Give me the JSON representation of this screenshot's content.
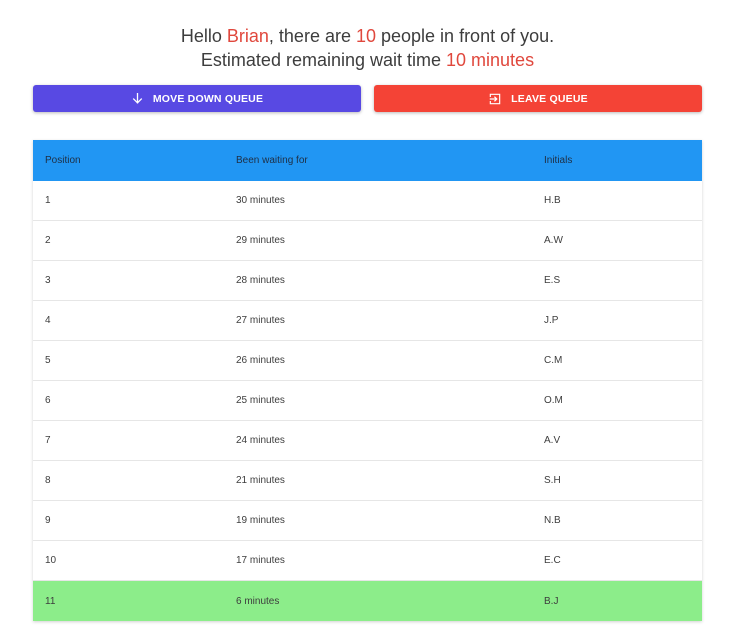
{
  "greeting": {
    "hello": "Hello ",
    "name": "Brian",
    "mid": ", there are ",
    "count": "10",
    "tail": " people in front of you.",
    "wait_prefix": "Estimated remaining wait time ",
    "wait_time": "10 minutes"
  },
  "actions": {
    "move_down_label": "MOVE DOWN QUEUE",
    "move_down_icon": "arrow-down-icon",
    "leave_label": "LEAVE QUEUE",
    "leave_icon": "exit-icon"
  },
  "colors": {
    "accent_text": "#e0483d",
    "move_button": "#5849e3",
    "leave_button": "#f44336",
    "header": "#2196f3",
    "current_user_row": "#8ced8a"
  },
  "table": {
    "headers": [
      "Position",
      "Been waiting for",
      "Initials"
    ],
    "rows": [
      {
        "position": "1",
        "waiting": "30 minutes",
        "initials": "H.B"
      },
      {
        "position": "2",
        "waiting": "29 minutes",
        "initials": "A.W"
      },
      {
        "position": "3",
        "waiting": "28 minutes",
        "initials": "E.S"
      },
      {
        "position": "4",
        "waiting": "27 minutes",
        "initials": "J.P"
      },
      {
        "position": "5",
        "waiting": "26 minutes",
        "initials": "C.M"
      },
      {
        "position": "6",
        "waiting": "25 minutes",
        "initials": "O.M"
      },
      {
        "position": "7",
        "waiting": "24 minutes",
        "initials": "A.V"
      },
      {
        "position": "8",
        "waiting": "21 minutes",
        "initials": "S.H"
      },
      {
        "position": "9",
        "waiting": "19 minutes",
        "initials": "N.B"
      },
      {
        "position": "10",
        "waiting": "17 minutes",
        "initials": "E.C"
      },
      {
        "position": "11",
        "waiting": "6 minutes",
        "initials": "B.J"
      }
    ],
    "current_user_index": 10
  }
}
